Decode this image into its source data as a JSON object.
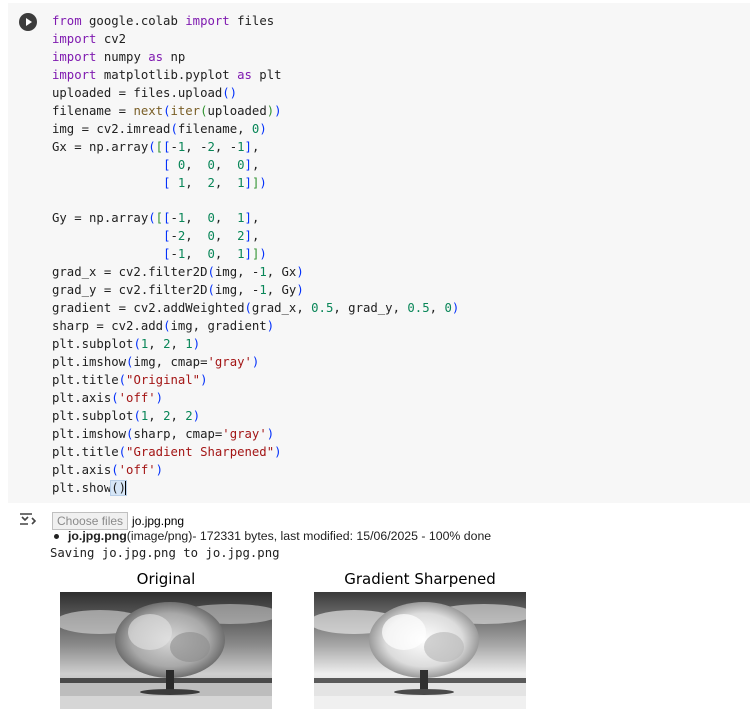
{
  "code_lines": [
    "from google.colab import files",
    "import cv2",
    "import numpy as np",
    "import matplotlib.pyplot as plt",
    "uploaded = files.upload()",
    "filename = next(iter(uploaded))",
    "img = cv2.imread(filename, 0)",
    "Gx = np.array([[-1, -2, -1],",
    "               [ 0,  0,  0],",
    "               [ 1,  2,  1]])",
    "",
    "Gy = np.array([[-1,  0,  1],",
    "               [-2,  0,  2],",
    "               [-1,  0,  1]])",
    "grad_x = cv2.filter2D(img, -1, Gx)",
    "grad_y = cv2.filter2D(img, -1, Gy)",
    "gradient = cv2.addWeighted(grad_x, 0.5, grad_y, 0.5, 0)",
    "sharp = cv2.add(img, gradient)",
    "plt.subplot(1, 2, 1)",
    "plt.imshow(img, cmap='gray')",
    "plt.title(\"Original\")",
    "plt.axis('off')",
    "plt.subplot(1, 2, 2)",
    "plt.imshow(sharp, cmap='gray')",
    "plt.title(\"Gradient Sharpened\")",
    "plt.axis('off')",
    "plt.show()"
  ],
  "output": {
    "choose_files_label": "Choose files",
    "chosen_file": "jo.jpg.png",
    "file_name": "jo.jpg.png",
    "file_type": "(image/png)",
    "file_details": " - 172331 bytes, last modified: 15/06/2025 - 100% done",
    "saving_text": "Saving jo.jpg.png to jo.jpg.png",
    "plot_titles": [
      "Original",
      "Gradient Sharpened"
    ]
  },
  "icons": {
    "run": "play-icon",
    "output": "output-toggle-icon"
  }
}
